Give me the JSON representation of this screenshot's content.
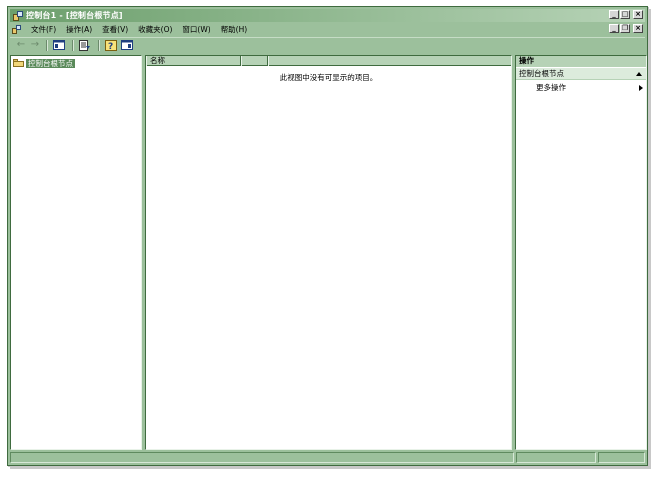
{
  "window": {
    "title": "控制台1 - [控制台根节点]",
    "buttons": {
      "minimize": "_",
      "maximize": "□",
      "close": "×",
      "restore": "❐"
    }
  },
  "menu": {
    "items": [
      {
        "label": "文件(F)"
      },
      {
        "label": "操作(A)"
      },
      {
        "label": "查看(V)"
      },
      {
        "label": "收藏夹(O)"
      },
      {
        "label": "窗口(W)"
      },
      {
        "label": "帮助(H)"
      }
    ]
  },
  "toolbar": {
    "back_glyph": "←",
    "forward_glyph": "→"
  },
  "tree": {
    "root_label": "控制台根节点"
  },
  "list": {
    "columns": [
      "名称",
      "",
      ""
    ],
    "empty_message": "此视图中没有可显示的项目。"
  },
  "actions": {
    "header": "操作",
    "group_label": "控制台根节点",
    "more_actions": "更多操作"
  },
  "colors": {
    "window_bg": "#9cc09c",
    "title_gradient_start": "#6c9f6c",
    "header_bg": "#b6d2b6",
    "selection_bg": "#5a8a5a"
  }
}
